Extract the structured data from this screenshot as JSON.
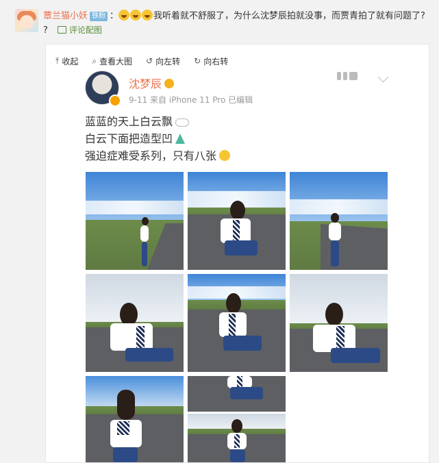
{
  "comment": {
    "username": "蕈兰猫小妖",
    "badge": "铁粉",
    "colon": "：",
    "text": "我听着就不舒服了，为什么沈梦辰拍就没事，而贾青拍了就有问题了? ?",
    "view_image_link": "评论配图"
  },
  "viewer": {
    "toolbar": {
      "collapse": "收起",
      "view_large": "查看大图",
      "rotate_left": "向左转",
      "rotate_right": "向右转"
    },
    "post": {
      "author": "沈梦辰",
      "meta": "9-11  来自 iPhone 11 Pro  已编辑",
      "lines": [
        "蓝蓝的天上白云飘",
        "白云下面把造型凹",
        "强迫症难受系列，只有八张"
      ]
    }
  },
  "colors": {
    "username": "#eb7350",
    "link": "#5a8c3b"
  },
  "icons": [
    "arrow-up-icon",
    "search-icon",
    "rotate-left-icon",
    "rotate-right-icon",
    "cloud-emoji-icon",
    "dress-emoji-icon",
    "smile-emoji-icon"
  ]
}
